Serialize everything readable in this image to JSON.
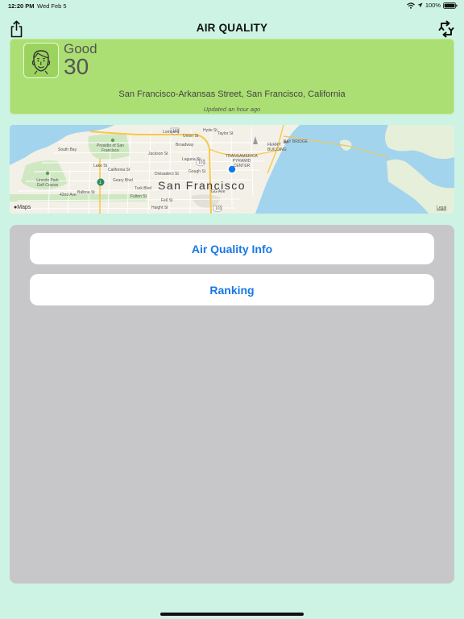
{
  "status": {
    "time": "12:20 PM",
    "date": "Wed Feb 5",
    "battery": "100%",
    "icons": [
      "wifi-icon",
      "location-arrow-icon",
      "battery-icon"
    ]
  },
  "nav": {
    "title": "AIR QUALITY",
    "left_icon": "share-icon",
    "right_icon": "refresh-icon"
  },
  "air_quality": {
    "level": "Good",
    "value": "30",
    "location": "San Francisco-Arkansas Street, San Francisco, California",
    "updated": "Updated an hour ago",
    "face_icon": "smiling-face-icon",
    "color": "#abdf73"
  },
  "map": {
    "city_label": "San Francisco",
    "attribution": "Maps",
    "legal": "Legal",
    "labels": {
      "south_bay": "South Bay",
      "presidio": "Presidio of San Francisco",
      "jackson": "Jackson St",
      "broadway": "Broadway",
      "union": "Union St",
      "lombard": "Lombard",
      "california": "California St",
      "geary": "Geary Blvd",
      "turk": "Turk Blvd",
      "balboa": "Balboa St",
      "fulton": "Fulton St",
      "fell": "Fell St",
      "haight": "Haight St",
      "lincoln_park": "Lincoln Park Golf Course",
      "transamerica": "TRANSAMERICA PYRAMID CENTER",
      "ferry": "FERRY BUILDING",
      "bay_bridge": "BAY BRIDGE",
      "hwy_101_a": "101",
      "hwy_101_b": "101",
      "hwy_101_c": "101",
      "hwy_1": "1",
      "hyde": "Hyde St",
      "taylor": "Taylor St",
      "laguna": "Laguna St",
      "gough": "Gough St",
      "divisadero": "Divisadero St",
      "gg_ave": "GG Ave",
      "lake": "Lake St",
      "42nd": "42nd Ave"
    }
  },
  "buttons": {
    "info": "Air Quality Info",
    "ranking": "Ranking"
  },
  "colors": {
    "background": "#cdf3e5",
    "accent": "#1877e6",
    "panel": "#c7c7c9"
  }
}
